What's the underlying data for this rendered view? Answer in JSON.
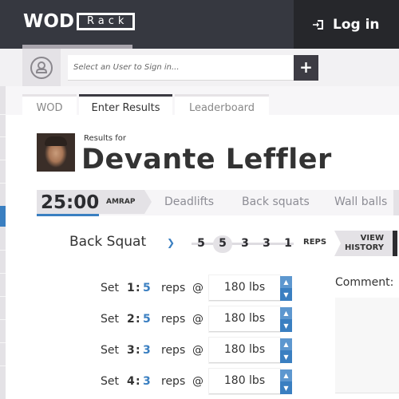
{
  "header": {
    "logo_primary": "WOD",
    "logo_secondary": "Rack",
    "login_label": "Log in",
    "login_icon": "login-icon"
  },
  "user_select": {
    "placeholder": "Select an User to Sign in...",
    "add_label": "+",
    "avatar_icon": "user-icon"
  },
  "tabs": [
    {
      "label": "WOD",
      "active": false
    },
    {
      "label": "Enter Results",
      "active": true
    },
    {
      "label": "Leaderboard",
      "active": false
    }
  ],
  "athlete": {
    "results_for_label": "Results for",
    "name": "Devante Leffler"
  },
  "wod": {
    "time": "25:00",
    "type": "AMRAP",
    "exercises": [
      "Deadlifts",
      "Back squats",
      "Wall balls"
    ]
  },
  "movement": {
    "name": "Back Squat",
    "rep_scheme": [
      "5",
      "5",
      "3",
      "3",
      "1"
    ],
    "current_index": 1,
    "reps_label": "REPS",
    "view_history_line1": "VIEW",
    "view_history_line2": "HISTORY"
  },
  "sets": [
    {
      "label": "Set",
      "number": "1",
      "reps": "5",
      "reps_word": "reps",
      "at": "@",
      "weight": "180 lbs"
    },
    {
      "label": "Set",
      "number": "2",
      "reps": "5",
      "reps_word": "reps",
      "at": "@",
      "weight": "180 lbs"
    },
    {
      "label": "Set",
      "number": "3",
      "reps": "3",
      "reps_word": "reps",
      "at": "@",
      "weight": "180 lbs"
    },
    {
      "label": "Set",
      "number": "4",
      "reps": "3",
      "reps_word": "reps",
      "at": "@",
      "weight": "180 lbs"
    }
  ],
  "comment": {
    "label": "Comment:",
    "value": ""
  },
  "colors": {
    "accent": "#3a7fc1",
    "header_bg": "#363840",
    "login_bg": "#26272b"
  }
}
